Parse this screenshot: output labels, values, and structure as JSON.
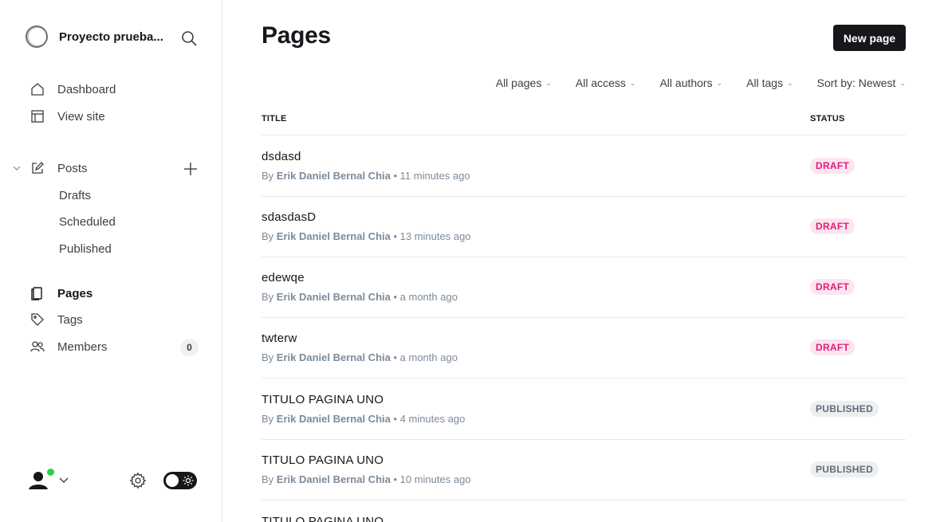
{
  "sidebar": {
    "site_name": "Proyecto prueba...",
    "nav": [
      {
        "label": "Dashboard",
        "icon": "house-icon"
      },
      {
        "label": "View site",
        "icon": "layout-icon"
      }
    ],
    "posts": {
      "label": "Posts",
      "sub": [
        "Drafts",
        "Scheduled",
        "Published"
      ]
    },
    "nav2": [
      {
        "label": "Pages",
        "icon": "page-icon",
        "active": true
      },
      {
        "label": "Tags",
        "icon": "tag-icon"
      },
      {
        "label": "Members",
        "icon": "members-icon",
        "count": "0"
      }
    ]
  },
  "main": {
    "title": "Pages",
    "new_button": "New page",
    "filters": [
      "All pages",
      "All access",
      "All authors",
      "All tags",
      "Sort by: Newest"
    ],
    "columns": {
      "title": "TITLE",
      "status": "STATUS"
    },
    "rows": [
      {
        "title": "dsdasd",
        "by": "By",
        "author": "Erik Daniel Bernal Chia",
        "time": "• 11 minutes ago",
        "status": "DRAFT"
      },
      {
        "title": "sdasdasD",
        "by": "By",
        "author": "Erik Daniel Bernal Chia",
        "time": "• 13 minutes ago",
        "status": "DRAFT"
      },
      {
        "title": "edewqe",
        "by": "By",
        "author": "Erik Daniel Bernal Chia",
        "time": "• a month ago",
        "status": "DRAFT"
      },
      {
        "title": "twterw",
        "by": "By",
        "author": "Erik Daniel Bernal Chia",
        "time": "• a month ago",
        "status": "DRAFT"
      },
      {
        "title": "TITULO PAGINA UNO",
        "by": "By",
        "author": "Erik Daniel Bernal Chia",
        "time": "• 4 minutes ago",
        "status": "PUBLISHED"
      },
      {
        "title": "TITULO PAGINA UNO",
        "by": "By",
        "author": "Erik Daniel Bernal Chia",
        "time": "• 10 minutes ago",
        "status": "PUBLISHED"
      },
      {
        "title": "TITULO PAGINA UNO",
        "by": "",
        "author": "",
        "time": "",
        "status": ""
      }
    ]
  },
  "colors": {
    "accent": "#15171a",
    "draft_bg": "#fce4f0",
    "draft_text": "#e11e79",
    "online": "#30cf43"
  }
}
